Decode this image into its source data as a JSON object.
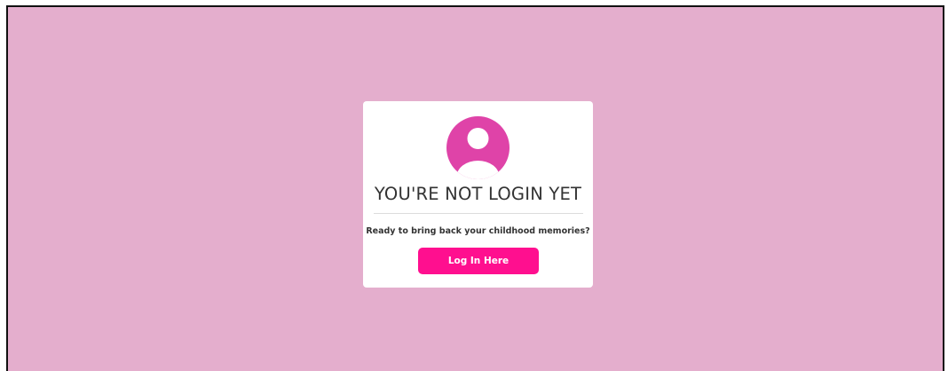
{
  "colors": {
    "background": "#e4aecd",
    "card": "#ffffff",
    "accent": "#df43a8",
    "button": "#ff0f8f",
    "button_text": "#ffffff",
    "text": "#333333"
  },
  "card": {
    "icon": "user-avatar-icon",
    "title": "YOU'RE NOT LOGIN YET",
    "subtitle": "Ready to bring back your childhood memories?",
    "button_label": "Log In Here"
  }
}
